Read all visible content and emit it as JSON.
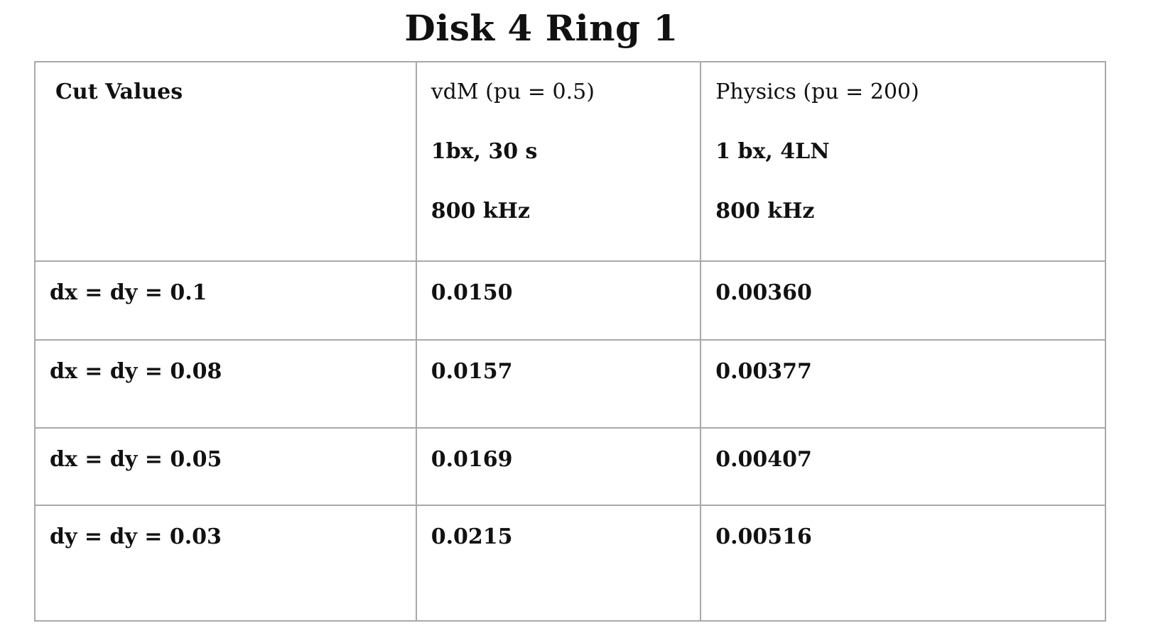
{
  "title": "Disk 4 Ring 1",
  "table": {
    "header": {
      "col1": [
        "Cut Values"
      ],
      "col2": [
        "vdM (pu = 0.5)",
        "1bx, 30 s",
        "800 kHz"
      ],
      "col3": [
        "Physics (pu = 200)",
        "1 bx, 4LN",
        "800 kHz"
      ]
    },
    "rows": [
      {
        "cut": "dx = dy = 0.1",
        "vdm": "0.0150",
        "physics": "0.00360"
      },
      {
        "cut": "dx = dy = 0.08",
        "vdm": "0.0157",
        "physics": "0.00377"
      },
      {
        "cut": "dx = dy = 0.05",
        "vdm": "0.0169",
        "physics": "0.00407"
      },
      {
        "cut": "dy = dy = 0.03",
        "vdm": "0.0215",
        "physics": "0.00516"
      }
    ]
  }
}
